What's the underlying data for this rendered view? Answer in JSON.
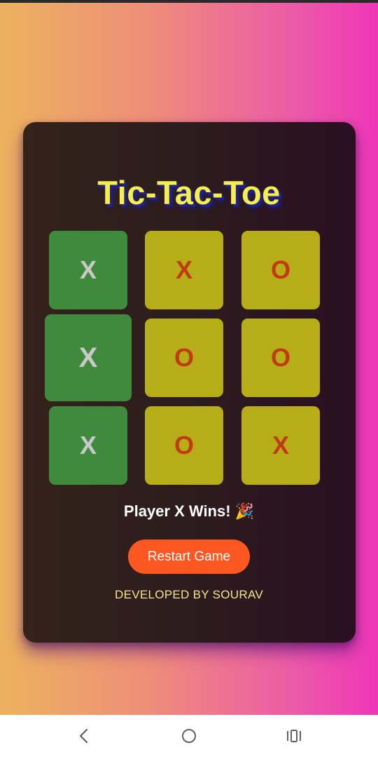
{
  "app": {
    "title": "Tic-Tac-Toe",
    "status": "Player X Wins! 🎉",
    "restart_label": "Restart Game",
    "developer": "DEVELOPED BY SOURAV"
  },
  "board": {
    "cells": [
      "X",
      "X",
      "O",
      "X",
      "O",
      "O",
      "X",
      "O",
      "X"
    ],
    "winning_line": [
      0,
      3,
      6
    ]
  },
  "colors": {
    "background_gradient": [
      "#ecb25e",
      "#ee8f78",
      "#ec5aa8",
      "#ef36b7"
    ],
    "card": "#2c1b1e",
    "title": "#f6ee4d",
    "winning_cell": "#408a3e",
    "cell": "#b7ad16",
    "mark": "#c23a12",
    "winning_mark": "#c9c9c9",
    "restart_button": "#ff5722",
    "developer_text": "#f2e68e"
  },
  "navbar": {
    "back_icon": "back-chevron-icon",
    "home_icon": "home-circle-icon",
    "recents_icon": "recents-icon"
  }
}
